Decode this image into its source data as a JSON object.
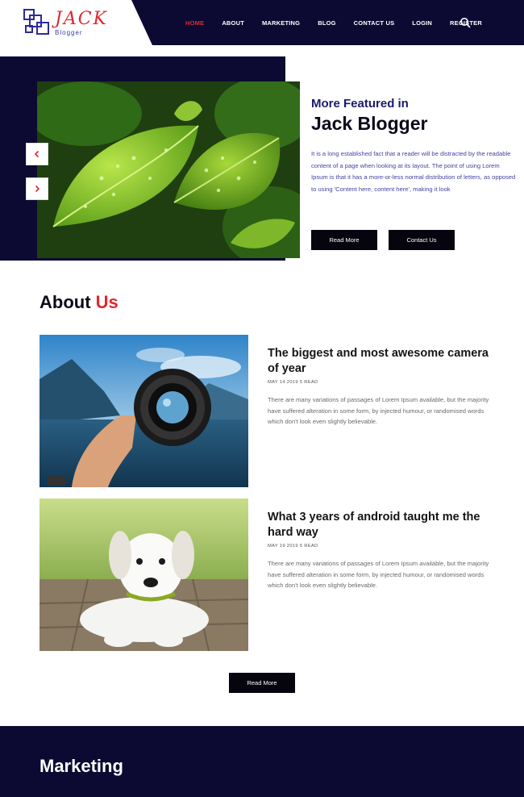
{
  "brand": {
    "name": "JACK",
    "subtitle": "Blogger",
    "accent": "#e0282f",
    "dark": "#0c0a33"
  },
  "nav": {
    "items": [
      {
        "label": "HOME",
        "active": true
      },
      {
        "label": "ABOUT",
        "active": false
      },
      {
        "label": "MARKETING",
        "active": false
      },
      {
        "label": "BLOG",
        "active": false
      },
      {
        "label": "CONTACT US",
        "active": false
      },
      {
        "label": "LOGIN",
        "active": false
      },
      {
        "label": "REGISTER",
        "active": false
      }
    ],
    "search_icon": "search-icon"
  },
  "hero": {
    "kicker": "More Featured in",
    "title": "Jack Blogger",
    "text": "It is a long established fact that a reader will be distracted by the readable content of a page when looking at its layout. The point of using Lorem Ipsum is that it has a more-or-less normal distribution of letters, as opposed to using 'Content here, content here', making it look",
    "read_more": "Read More",
    "contact_us": "Contact Us"
  },
  "about": {
    "title_main": "About",
    "title_accent": "Us",
    "posts": [
      {
        "title": "The biggest and most awesome camera of year",
        "meta": "MAY 14 2019 5 READ",
        "text": "There are many variations of passages of Lorem Ipsum available, but the majority have suffered alteration in some form, by injected humour, or randomised words which don't look even slightly believable."
      },
      {
        "title": "What 3 years of android taught me the hard way",
        "meta": "MAY 19 2019 5 READ",
        "text": "There are many variations of passages of Lorem Ipsum available, but the majority have suffered alteration in some form, by injected humour, or randomised words which don't look even slightly believable."
      }
    ],
    "read_more": "Read More"
  },
  "marketing": {
    "title": "Marketing"
  }
}
